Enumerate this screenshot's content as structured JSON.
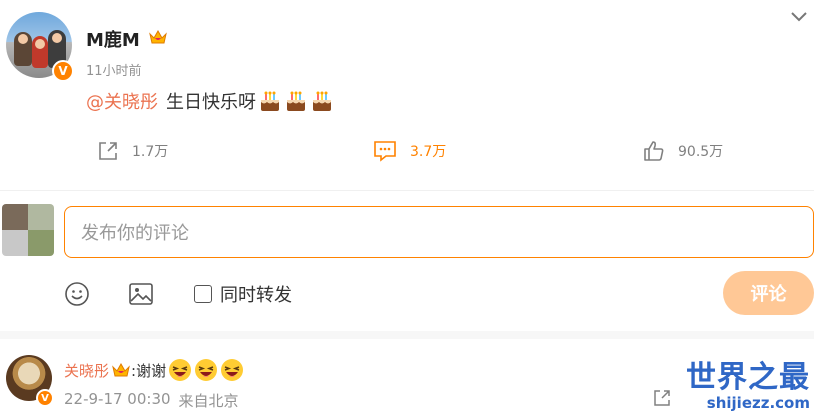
{
  "post": {
    "author": "M鹿M",
    "time": "11小时前",
    "mention": "@关晓彤",
    "text": "生日快乐呀"
  },
  "actions": {
    "share_count": "1.7万",
    "comment_count": "3.7万",
    "like_count": "90.5万"
  },
  "composer": {
    "placeholder": "发布你的评论",
    "repost_label": "同时转发",
    "repost_checked": false,
    "submit_label": "评论"
  },
  "reply": {
    "author": "关晓彤",
    "text": ":谢谢",
    "date": "22-9-17 00:30",
    "source": "来自北京"
  },
  "watermark": {
    "title": "世界之最",
    "domain": "shijiezz.com"
  },
  "colors": {
    "accent": "#ff8200",
    "mention": "#eb7350",
    "submit_disabled": "#ffc896"
  }
}
